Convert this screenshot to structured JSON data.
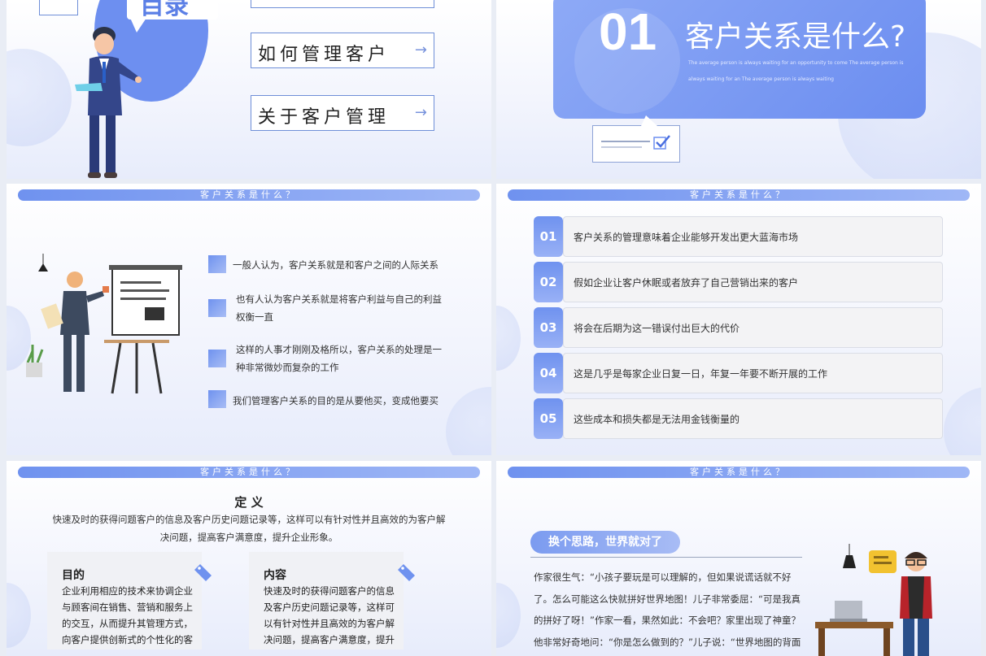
{
  "slide1": {
    "heading_fragment": "目录",
    "menu": [
      {
        "label": "",
        "arrow": ""
      },
      {
        "label": "如何管理客户",
        "arrow": "→"
      },
      {
        "label": "关于客户管理",
        "arrow": "→"
      }
    ]
  },
  "slide2": {
    "number": "01",
    "title": "客户关系是什么?",
    "subtitle_1": "The average person is always waiting for an opportunity to come The average person is",
    "subtitle_2": "always waiting for an  The average person is always waiting"
  },
  "slide3": {
    "bar_title": "客户关系是什么？",
    "points": [
      [
        "一般人认为，客户关系就是和客户之间的人际关系"
      ],
      [
        "也有人认为客户关系就是将客户利益与自己的利益",
        "权衡一直"
      ],
      [
        "这样的人事才刚刚及格所以，客户关系的处理是一",
        "种非常微妙而复杂的工作"
      ],
      [
        "我们管理客户关系的目的是从要他买，变成他要买"
      ]
    ]
  },
  "slide4": {
    "bar_title": "客户关系是什么？",
    "rows": [
      {
        "num": "01",
        "text": "客户关系的管理意味着企业能够开发出更大蓝海市场"
      },
      {
        "num": "02",
        "text": "假如企业让客户休眠或者放弃了自己营销出来的客户"
      },
      {
        "num": "03",
        "text": "将会在后期为这一错误付出巨大的代价"
      },
      {
        "num": "04",
        "text": "这是几乎是每家企业日复一日，年复一年要不断开展的工作"
      },
      {
        "num": "05",
        "text": "这些成本和损失都是无法用金钱衡量的"
      }
    ]
  },
  "slide5": {
    "bar_title": "客户关系是什么？",
    "def_title": "定 义",
    "def_line1": "快速及时的获得问题客户的信息及客户历史问题记录等，这样可以有针对性并且高效的为客户解",
    "def_line2": "决问题，提高客户满意度，提升企业形象。",
    "card1": {
      "title": "目的",
      "text": "企业利用相应的技术来协调企业与顾客间在销售、营销和服务上的交互，从而提升其管理方式，向客户提供创新式的个性化的客"
    },
    "card2": {
      "title": "内容",
      "text": "快速及时的获得问题客户的信息及客户历史问题记录等，这样可以有针对性并且高效的为客户解决问题，提高客户满意度，提升"
    }
  },
  "slide6": {
    "bar_title": "客户关系是什么？",
    "pill": "换个思路，世界就对了",
    "story": "作家很生气：“小孩子要玩是可以理解的，但如果说谎话就不好了。怎么可能这么快就拼好世界地图！儿子非常委屈：“可是我真的拼好了呀！”作家一看，果然如此：不会吧？家里出现了神童？他非常好奇地问：“你是怎么做到的？”儿子说：“世界地图的背面是"
  }
}
